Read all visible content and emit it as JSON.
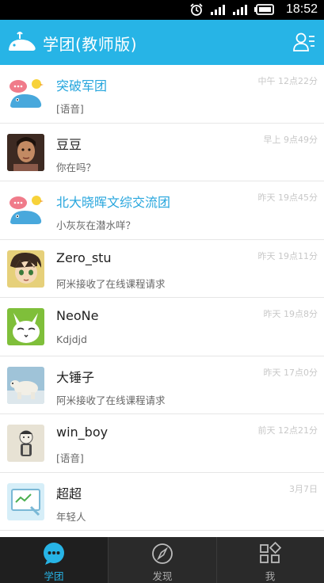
{
  "status_bar": {
    "time": "18:52",
    "icons": [
      "alarm-icon",
      "signal-icon",
      "signal-icon",
      "battery-icon"
    ]
  },
  "header": {
    "title": "学团(教师版)",
    "logo_icon": "whale-logo-icon",
    "contacts_icon": "contacts-icon"
  },
  "colors": {
    "accent": "#27b4e6",
    "group_name": "#27a6dd",
    "tabbar_bg": "#2a2a2a"
  },
  "conversations": [
    {
      "name": "突破军团",
      "message": "[语音]",
      "time": "中午 12点22分",
      "is_group": true,
      "avatar": "group-whale"
    },
    {
      "name": "豆豆",
      "message": "你在吗？",
      "time": "早上 9点49分",
      "is_group": false,
      "avatar": "girl-photo"
    },
    {
      "name": "北大晓晖文综交流团",
      "message": "小灰灰在潜水咩？",
      "time": "昨天 19点45分",
      "is_group": true,
      "avatar": "group-whale"
    },
    {
      "name": "Zero_stu",
      "message": "阿米接收了在线课程请求",
      "time": "昨天 19点11分",
      "is_group": false,
      "avatar": "anime-boy"
    },
    {
      "name": "NeoNe",
      "message": "Kdjdjd",
      "time": "昨天 19点8分",
      "is_group": false,
      "avatar": "rabbit-face"
    },
    {
      "name": "大锤子",
      "message": "阿米接收了在线课程请求",
      "time": "昨天 17点0分",
      "is_group": false,
      "avatar": "polar-bear"
    },
    {
      "name": "win_boy",
      "message": "[语音]",
      "time": "前天 12点21分",
      "is_group": false,
      "avatar": "snow-figure"
    },
    {
      "name": "超超",
      "message": "年轻人",
      "time": "3月7日",
      "is_group": false,
      "avatar": "blackboard"
    }
  ],
  "tabs": [
    {
      "label": "学团",
      "icon": "chat-bubble-icon",
      "active": true
    },
    {
      "label": "发现",
      "icon": "compass-icon",
      "active": false
    },
    {
      "label": "我",
      "icon": "grid-icon",
      "active": false
    }
  ]
}
